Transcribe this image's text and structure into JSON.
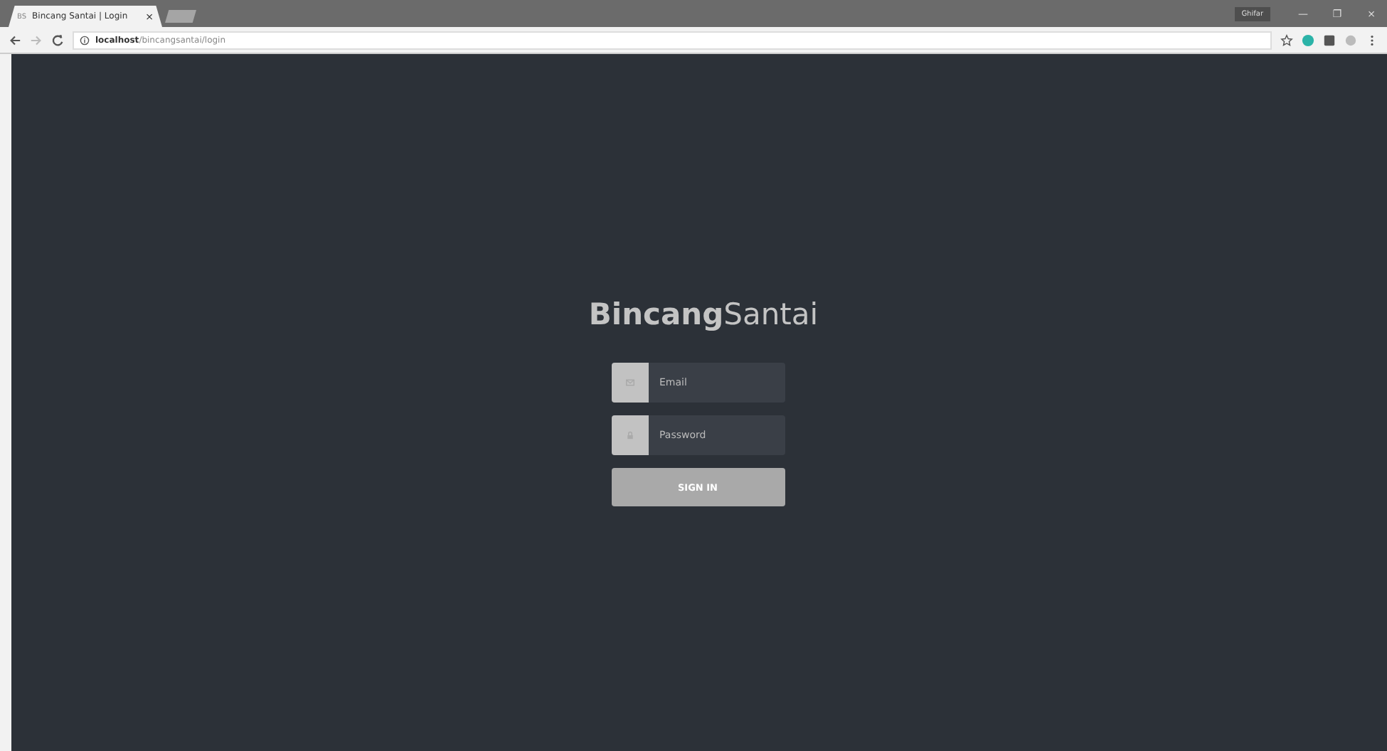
{
  "browser": {
    "tab": {
      "favicon": "BS",
      "title": "Bincang Santai | Login",
      "close": "×"
    },
    "profile": "Ghifar",
    "window_controls": [
      "—",
      "❐",
      "×"
    ],
    "url_host": "localhost",
    "url_path": "/bincangsantai/login"
  },
  "logo": "**Bincang**Santai",
  "fields": [
    {
      "placeholder": "Email",
      "kind": "email"
    },
    {
      "placeholder": "Password",
      "kind": "password"
    }
  ],
  "submit": "SIGN IN"
}
